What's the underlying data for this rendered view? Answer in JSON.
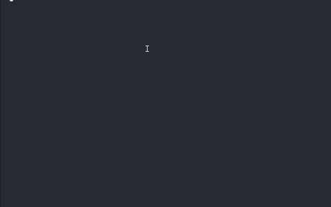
{
  "desktop": {
    "background_color": "#262a33",
    "cursor": {
      "icon": "text-cursor-icon",
      "color": "#cfd3dc"
    }
  }
}
